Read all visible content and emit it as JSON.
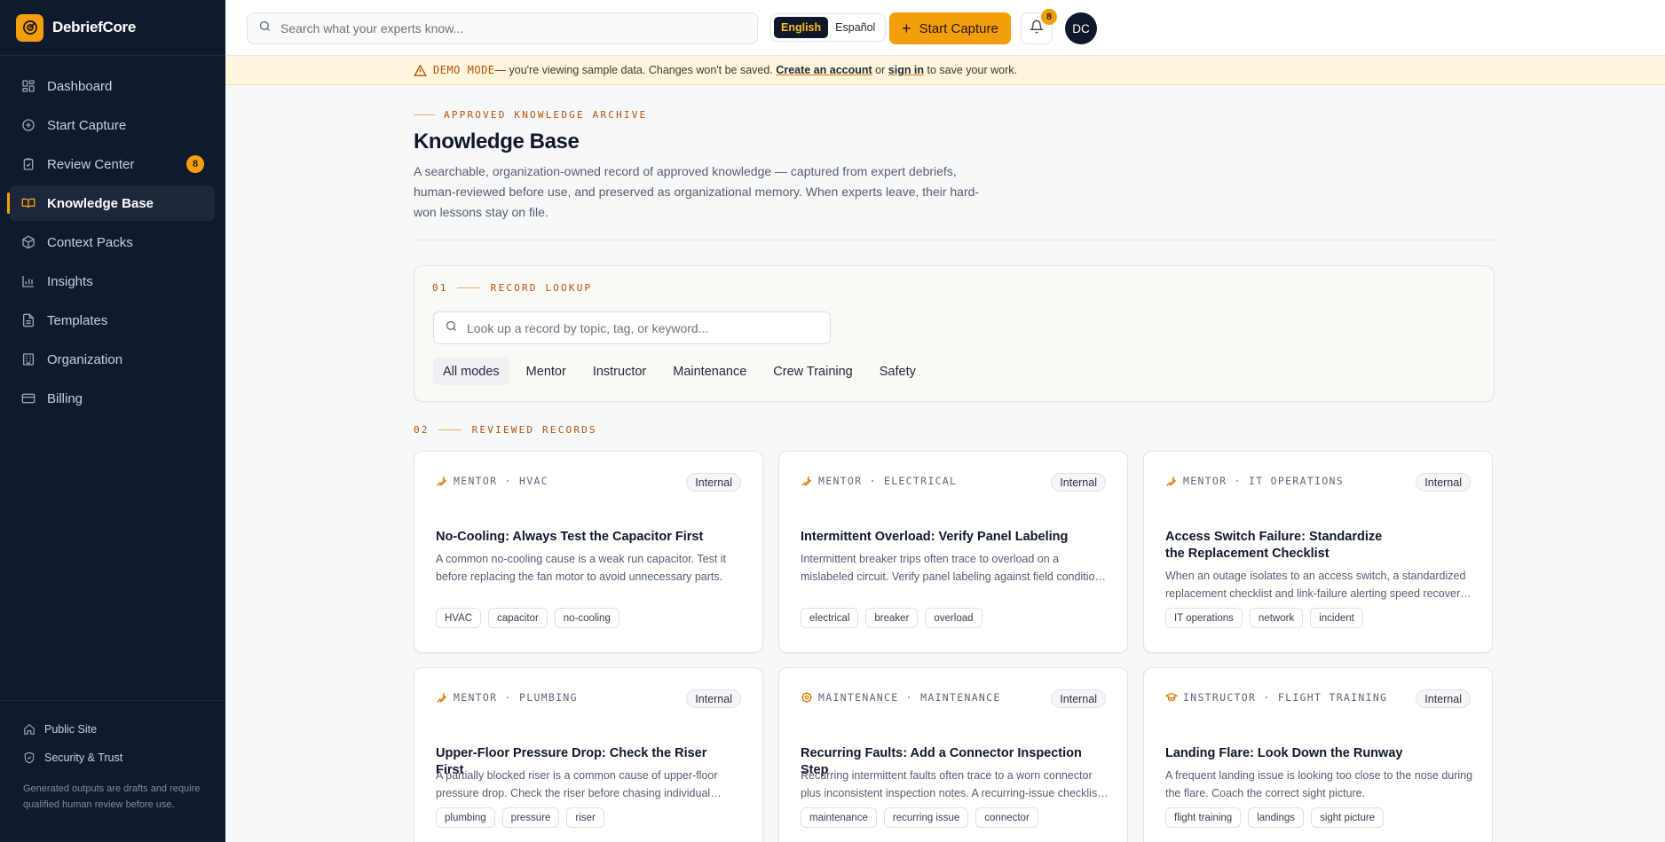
{
  "app": {
    "name": "DebriefCore"
  },
  "sidebar": {
    "items": [
      {
        "label": "Dashboard",
        "icon": "dashboard-icon"
      },
      {
        "label": "Start Capture",
        "icon": "plus-circle-icon"
      },
      {
        "label": "Review Center",
        "icon": "clipboard-check-icon",
        "badge": "8"
      },
      {
        "label": "Knowledge Base",
        "icon": "book-open-icon",
        "active": true
      },
      {
        "label": "Context Packs",
        "icon": "package-icon"
      },
      {
        "label": "Insights",
        "icon": "bar-chart-icon"
      },
      {
        "label": "Templates",
        "icon": "file-text-icon"
      },
      {
        "label": "Organization",
        "icon": "building-icon"
      },
      {
        "label": "Billing",
        "icon": "credit-card-icon"
      }
    ],
    "footer": {
      "public_site": "Public Site",
      "security": "Security & Trust",
      "note": "Generated outputs are drafts and require qualified human review before use."
    }
  },
  "topbar": {
    "search_placeholder": "Search what your experts know...",
    "lang_english": "English",
    "lang_spanish": "Español",
    "start_capture": "Start Capture",
    "notification_count": "8",
    "avatar_initials": "DC"
  },
  "banner": {
    "demo_label": "DEMO MODE",
    "text1": "— you're viewing sample data. Changes won't be saved.",
    "create_account": "Create an account",
    "or": "or",
    "sign_in": "sign in",
    "text2": "to save your work."
  },
  "header": {
    "eyebrow": "APPROVED KNOWLEDGE ARCHIVE",
    "title": "Knowledge Base",
    "description": "A searchable, organization-owned record of approved knowledge — captured from expert debriefs, human-reviewed before use, and preserved as organizational memory. When experts leave, their hard-won lessons stay on file."
  },
  "lookup": {
    "num": "01",
    "label": "RECORD LOOKUP",
    "placeholder": "Look up a record by topic, tag, or keyword...",
    "filters": [
      "All modes",
      "Mentor",
      "Instructor",
      "Maintenance",
      "Crew Training",
      "Safety"
    ],
    "active_filter": "All modes"
  },
  "records": {
    "num": "02",
    "label": "REVIEWED RECORDS",
    "cards": [
      {
        "meta": "MENTOR · HVAC",
        "icon": "wrench-icon",
        "visibility": "Internal",
        "title": "No-Cooling: Always Test the Capacitor First",
        "body": "A common no-cooling cause is a weak run capacitor. Test it before replacing the fan motor to avoid unnecessary parts.",
        "tags": [
          "HVAC",
          "capacitor",
          "no-cooling"
        ]
      },
      {
        "meta": "MENTOR · ELECTRICAL",
        "icon": "wrench-icon",
        "visibility": "Internal",
        "title": "Intermittent Overload: Verify Panel Labeling",
        "body": "Intermittent breaker trips often trace to overload on a mislabeled circuit. Verify panel labeling against field conditions before replacing hardware.",
        "tags": [
          "electrical",
          "breaker",
          "overload"
        ]
      },
      {
        "meta": "MENTOR · IT OPERATIONS",
        "icon": "wrench-icon",
        "visibility": "Internal",
        "title": "Access Switch Failure: Standardize the Replacement Checklist",
        "body": "When an outage isolates to an access switch, a standardized replacement checklist and link-failure alerting speed recovery and reduce errors.",
        "tags": [
          "IT operations",
          "network",
          "incident"
        ]
      },
      {
        "meta": "MENTOR · PLUMBING",
        "icon": "wrench-icon",
        "visibility": "Internal",
        "title": "Upper-Floor Pressure Drop: Check the Riser First",
        "body": "A partially blocked riser is a common cause of upper-floor pressure drop. Check the riser before chasing individual fixtures.",
        "tags": [
          "plumbing",
          "pressure",
          "riser"
        ]
      },
      {
        "meta": "MAINTENANCE · MAINTENANCE",
        "icon": "gear-icon",
        "visibility": "Internal",
        "title": "Recurring Faults: Add a Connector Inspection Step",
        "body": "Recurring intermittent faults often trace to a worn connector plus inconsistent inspection notes. A recurring-issue checklist step closes the gap.",
        "tags": [
          "maintenance",
          "recurring issue",
          "connector"
        ]
      },
      {
        "meta": "INSTRUCTOR · FLIGHT TRAINING",
        "icon": "graduation-cap-icon",
        "visibility": "Internal",
        "title": "Landing Flare: Look Down the Runway",
        "body": "A frequent landing issue is looking too close to the nose during the flare. Coach the correct sight picture.",
        "tags": [
          "flight training",
          "landings",
          "sight picture"
        ]
      }
    ]
  },
  "colors": {
    "accent": "#f59e0b",
    "sidebar_bg": "#0f1a2e",
    "eyebrow": "#b45309",
    "banner_bg": "#fdf6dd"
  }
}
